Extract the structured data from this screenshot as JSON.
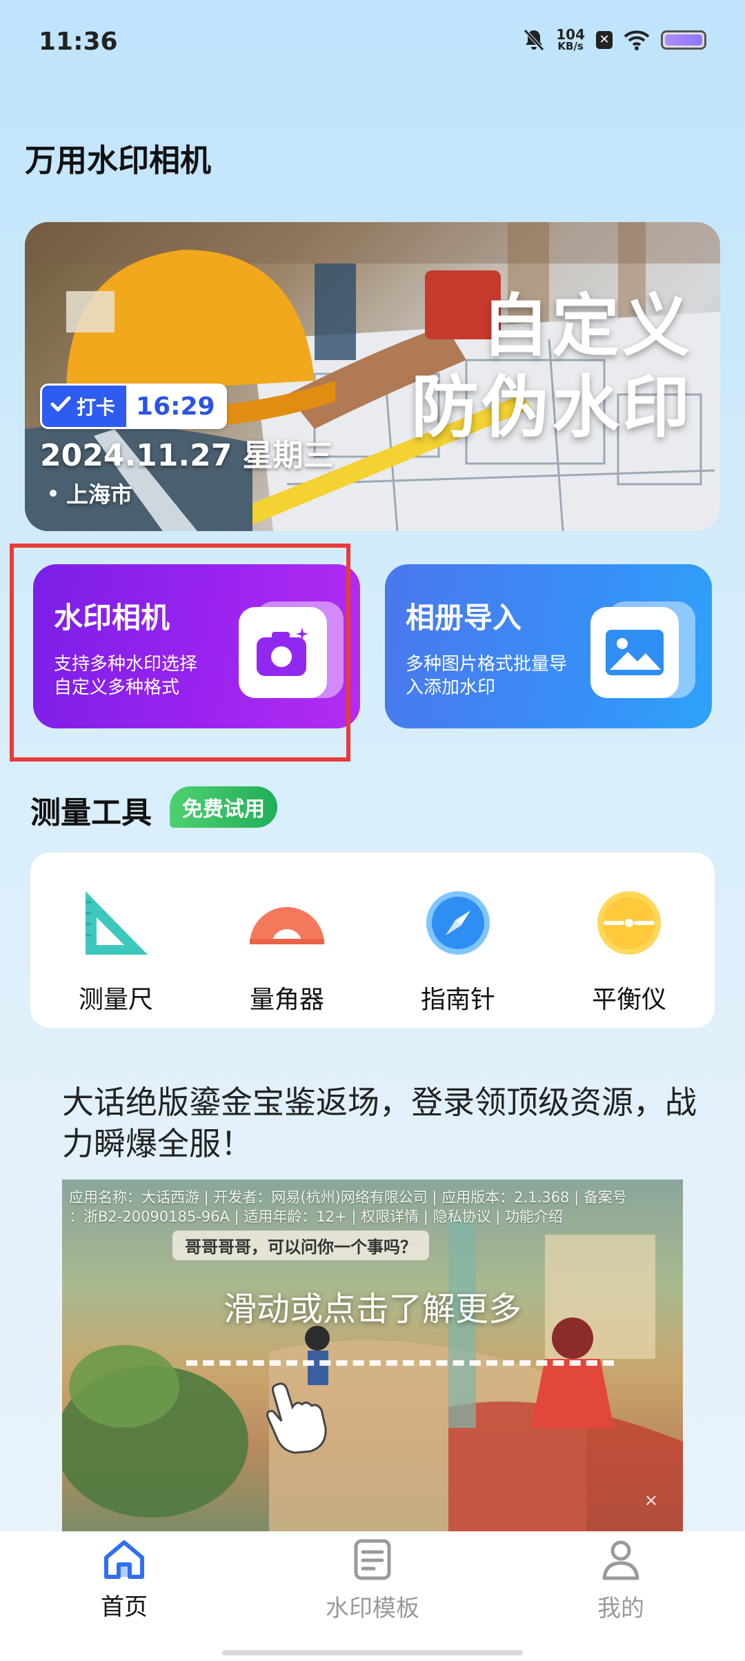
{
  "status_bar": {
    "time": "11:36",
    "net_speed_value": "104",
    "net_speed_unit": "KB/s",
    "notification_badge": "✕"
  },
  "app": {
    "title": "万用水印相机"
  },
  "banner": {
    "headline_line1": "自定义",
    "headline_line2": "防伪水印",
    "checkin_label": "打卡",
    "checkin_time": "16:29",
    "date": "2024.11.27 星期三",
    "location": "上海市"
  },
  "cards": {
    "camera": {
      "title": "水印相机",
      "desc_line1": "支持多种水印选择",
      "desc_line2": "自定义多种格式"
    },
    "album": {
      "title": "相册导入",
      "desc_line1": "多种图片格式批量导",
      "desc_line2": "入添加水印"
    }
  },
  "measure": {
    "title": "测量工具",
    "badge": "免费试用",
    "tools": [
      {
        "label": "测量尺",
        "icon": "ruler-triangle-icon"
      },
      {
        "label": "量角器",
        "icon": "protractor-icon"
      },
      {
        "label": "指南针",
        "icon": "compass-icon"
      },
      {
        "label": "平衡仪",
        "icon": "level-icon"
      }
    ]
  },
  "ad": {
    "headline": "大话绝版鎏金宝鉴返场，登录领顶级资源，战力瞬爆全服！",
    "info_line1": "应用名称：大话西游 | 开发者：网易(杭州)网络有限公司 | 应用版本：2.1.368 | 备案号",
    "info_line2": "：浙B2-20090185-96A | 适用年龄：12+ | 权限详情 | 隐私协议 | 功能介绍",
    "speech": "哥哥哥哥，可以问你一个事吗？",
    "cta": "滑动或点击了解更多"
  },
  "nav": {
    "items": [
      {
        "label": "首页",
        "icon": "home-icon",
        "active": true
      },
      {
        "label": "水印模板",
        "icon": "template-icon",
        "active": false
      },
      {
        "label": "我的",
        "icon": "profile-icon",
        "active": false
      }
    ],
    "active_color": "#2f6ff2",
    "inactive_color": "#9a9a9a"
  }
}
